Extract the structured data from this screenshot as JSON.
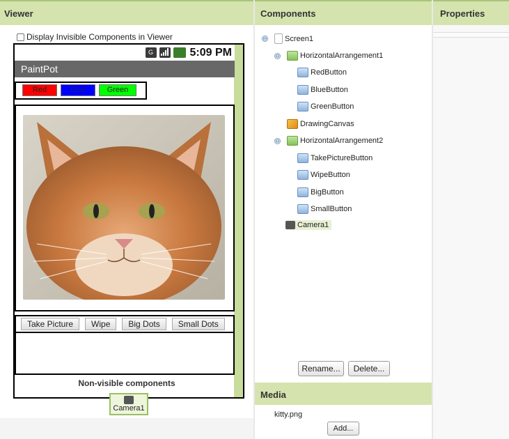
{
  "headers": {
    "viewer": "Viewer",
    "components": "Components",
    "properties": "Properties",
    "media": "Media"
  },
  "viewer": {
    "display_invisible_label": "Display Invisible Components in Viewer",
    "status_time": "5:09 PM",
    "app_title": "PaintPot",
    "color_buttons": [
      {
        "label": "Red",
        "bg": "#ff0000"
      },
      {
        "label": "Blue",
        "bg": "#0000ff"
      },
      {
        "label": "Green",
        "bg": "#00ff00"
      }
    ],
    "action_buttons": [
      "Take Picture",
      "Wipe",
      "Big Dots",
      "Small Dots"
    ],
    "nonvisible_title": "Non-visible components",
    "nonvisible_item": "Camera1"
  },
  "components_tree": [
    {
      "label": "Screen1",
      "icon": "screen-icon",
      "toggle": "⊖"
    },
    {
      "label": "HorizontalArrangement1",
      "icon": "horizontal-arrangement-icon",
      "toggle": "⊖"
    },
    {
      "label": "RedButton",
      "icon": "button-icon"
    },
    {
      "label": "BlueButton",
      "icon": "button-icon"
    },
    {
      "label": "GreenButton",
      "icon": "button-icon"
    },
    {
      "label": "DrawingCanvas",
      "icon": "canvas-icon"
    },
    {
      "label": "HorizontalArrangement2",
      "icon": "horizontal-arrangement-icon",
      "toggle": "⊖"
    },
    {
      "label": "TakePictureButton",
      "icon": "button-icon"
    },
    {
      "label": "WipeButton",
      "icon": "button-icon"
    },
    {
      "label": "BigButton",
      "icon": "button-icon"
    },
    {
      "label": "SmallButton",
      "icon": "button-icon"
    },
    {
      "label": "Camera1",
      "icon": "camera-icon",
      "selected": true
    }
  ],
  "component_actions": {
    "rename": "Rename...",
    "delete": "Delete..."
  },
  "media": {
    "file": "kitty.png",
    "add": "Add..."
  },
  "colors": {
    "header_bg": "#d5e3ae",
    "selection": "#e8f0d4",
    "phone_titlebar": "#686868"
  }
}
